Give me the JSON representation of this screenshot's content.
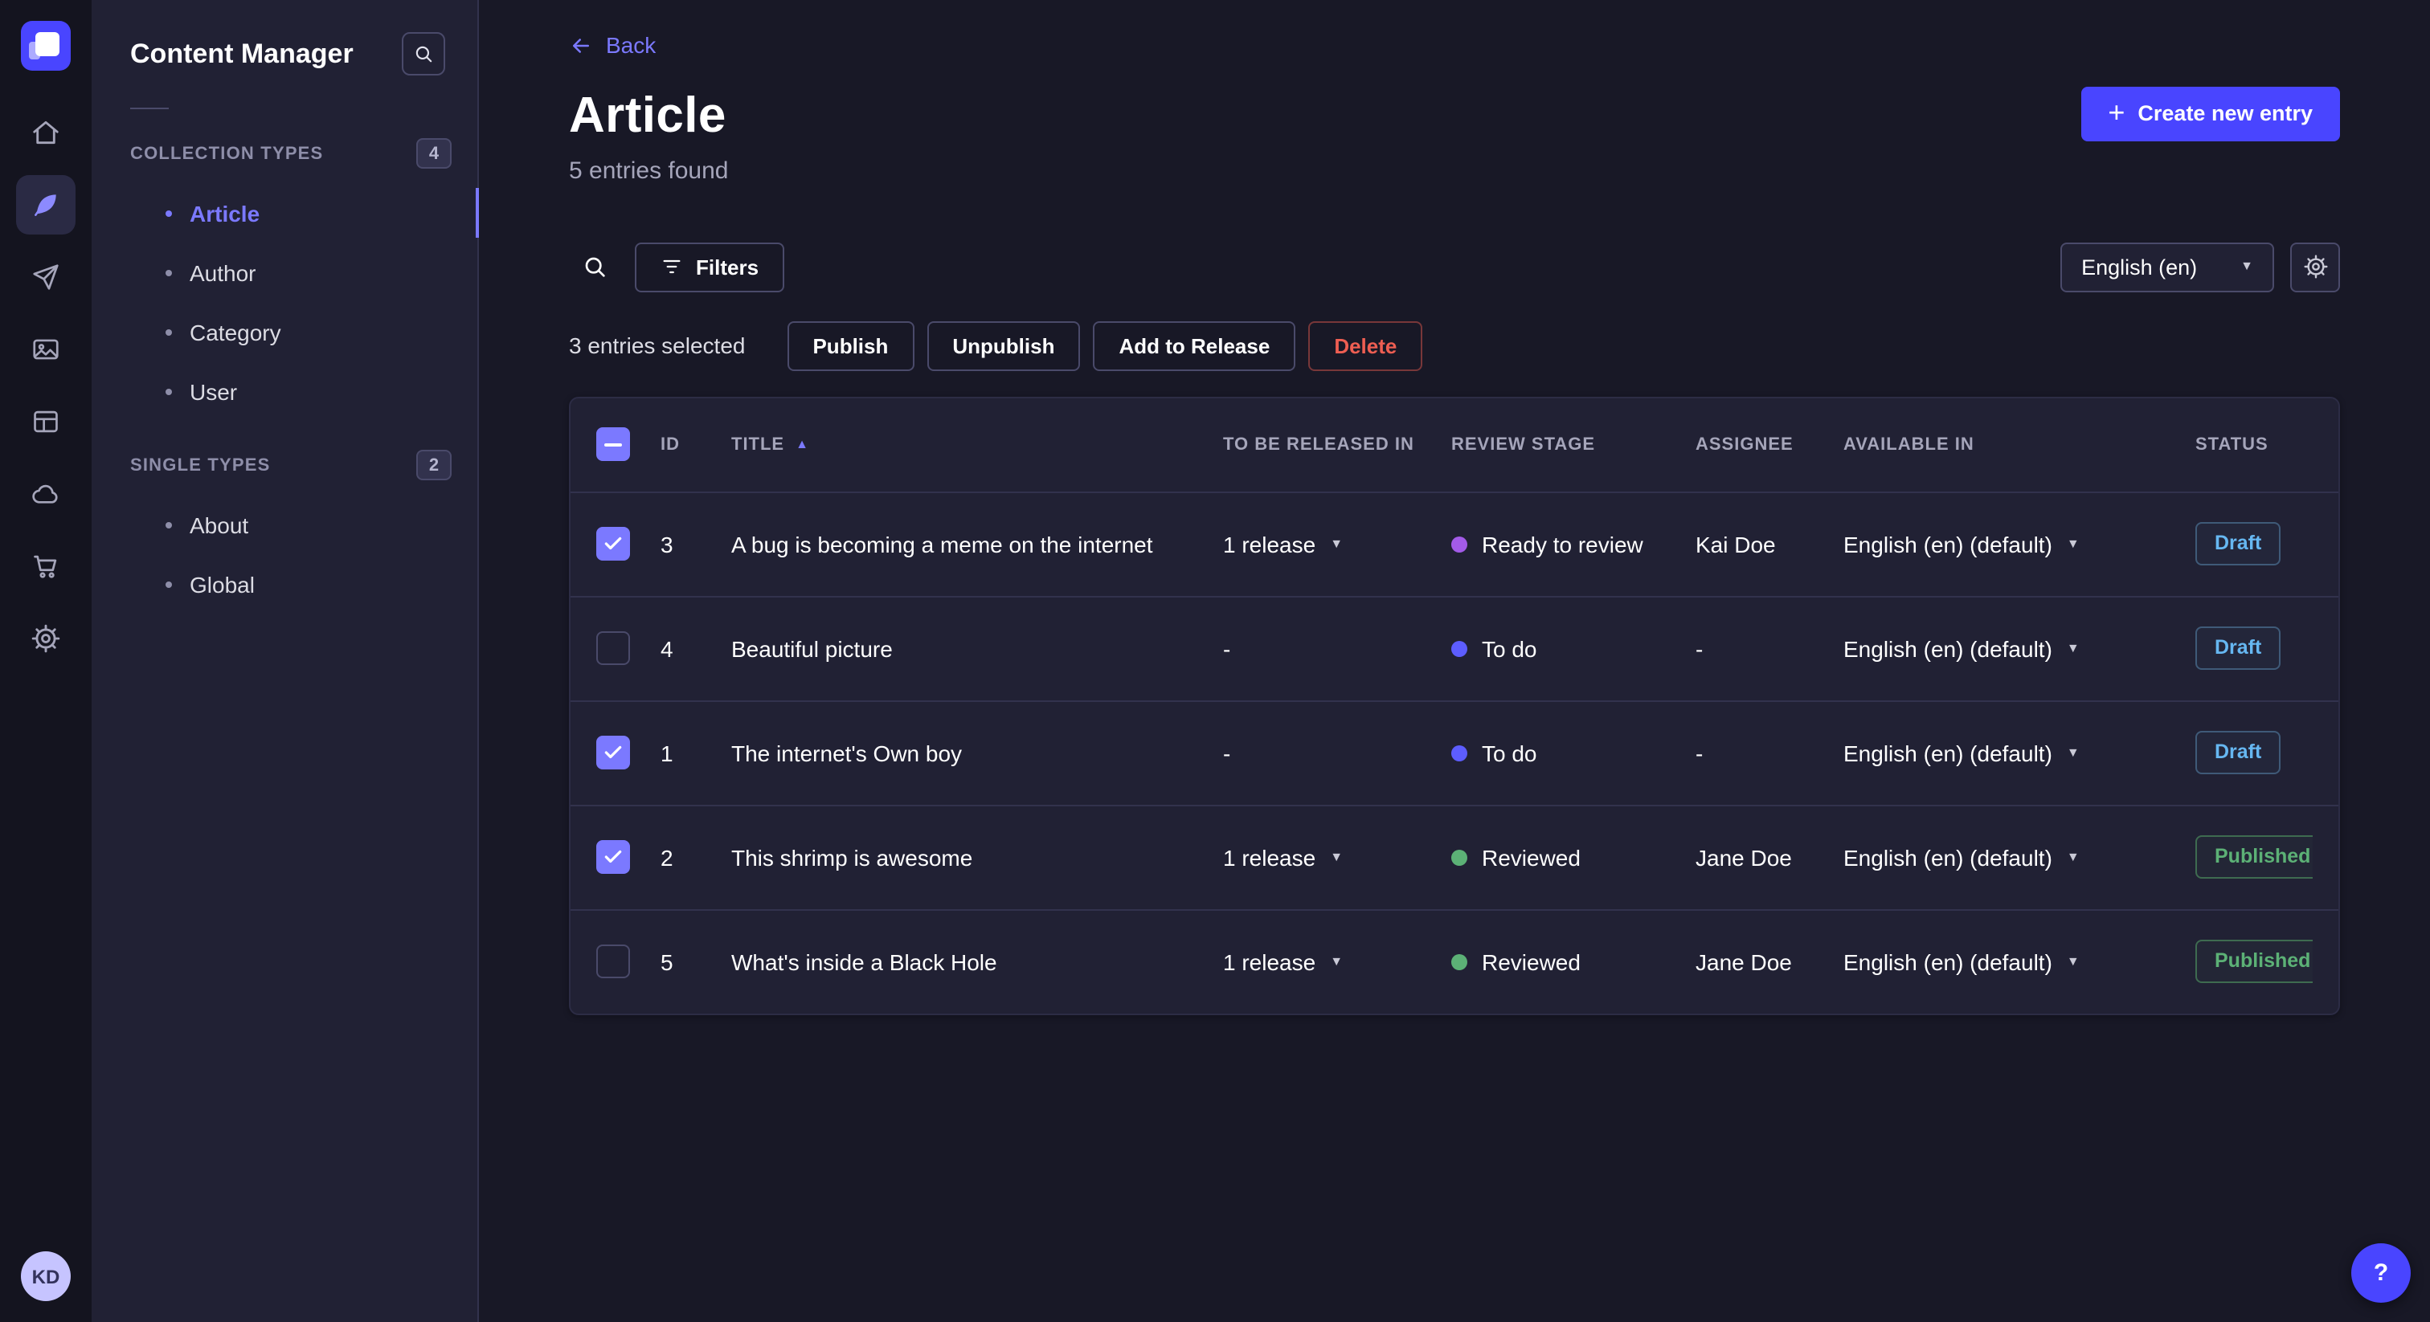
{
  "colors": {
    "primary": "#4945ff",
    "primary_light": "#7b79ff",
    "draft": "#66b7f1",
    "published": "#5cb176",
    "danger": "#ee5e52",
    "stage_ready_to_review": "#a35be8",
    "stage_to_do": "#5d5dff",
    "stage_reviewed": "#5cb176"
  },
  "nav_rail": {
    "logo": "strapi-logo",
    "icons": [
      "home",
      "content-manager",
      "releases",
      "media-library",
      "content-type-builder",
      "cloud",
      "marketplace",
      "settings"
    ],
    "active_icon": "content-manager",
    "avatar_initials": "KD"
  },
  "sidebar": {
    "title": "Content Manager",
    "collection_types": {
      "label": "COLLECTION TYPES",
      "badge": "4",
      "items": [
        {
          "label": "Article",
          "active": true
        },
        {
          "label": "Author",
          "active": false
        },
        {
          "label": "Category",
          "active": false
        },
        {
          "label": "User",
          "active": false
        }
      ]
    },
    "single_types": {
      "label": "SINGLE TYPES",
      "badge": "2",
      "items": [
        {
          "label": "About",
          "active": false
        },
        {
          "label": "Global",
          "active": false
        }
      ]
    }
  },
  "header": {
    "back_label": "Back",
    "title": "Article",
    "subtitle": "5 entries found",
    "create_button_label": "Create new entry"
  },
  "toolbar": {
    "filters_label": "Filters",
    "locale_selected": "English (en)"
  },
  "selection_bar": {
    "selected_text": "3 entries selected",
    "publish_label": "Publish",
    "unpublish_label": "Unpublish",
    "add_to_release_label": "Add to Release",
    "delete_label": "Delete"
  },
  "table": {
    "select_all_indeterminate": true,
    "columns": {
      "id": "ID",
      "title": "TITLE",
      "to_be_released_in": "TO BE RELEASED IN",
      "review_stage": "REVIEW STAGE",
      "assignee": "ASSIGNEE",
      "available_in": "AVAILABLE IN",
      "status": "STATUS"
    },
    "rows": [
      {
        "checked": true,
        "id": "3",
        "title": "A bug is becoming a meme on the internet",
        "release": "1 release",
        "has_release": true,
        "review_stage": "Ready to review",
        "review_color": "#a35be8",
        "assignee": "Kai Doe",
        "available_in": "English (en) (default)",
        "status": "Draft",
        "published": false
      },
      {
        "checked": false,
        "id": "4",
        "title": "Beautiful picture",
        "release": "-",
        "has_release": false,
        "review_stage": "To do",
        "review_color": "#5d5dff",
        "assignee": "-",
        "available_in": "English (en) (default)",
        "status": "Draft",
        "published": false
      },
      {
        "checked": true,
        "id": "1",
        "title": "The internet's Own boy",
        "release": "-",
        "has_release": false,
        "review_stage": "To do",
        "review_color": "#5d5dff",
        "assignee": "-",
        "available_in": "English (en) (default)",
        "status": "Draft",
        "published": false
      },
      {
        "checked": true,
        "id": "2",
        "title": "This shrimp is awesome",
        "release": "1 release",
        "has_release": true,
        "review_stage": "Reviewed",
        "review_color": "#5cb176",
        "assignee": "Jane Doe",
        "available_in": "English (en) (default)",
        "status": "Published",
        "published": true
      },
      {
        "checked": false,
        "id": "5",
        "title": "What's inside a Black Hole",
        "release": "1 release",
        "has_release": true,
        "review_stage": "Reviewed",
        "review_color": "#5cb176",
        "assignee": "Jane Doe",
        "available_in": "English (en) (default)",
        "status": "Published",
        "published": true
      }
    ]
  },
  "help_button": {
    "label": "?"
  }
}
